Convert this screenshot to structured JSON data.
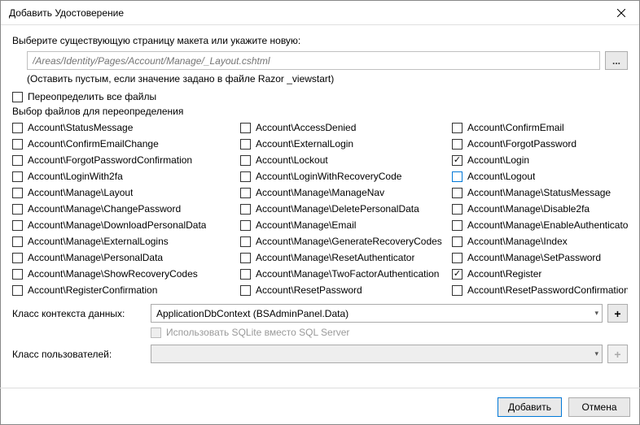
{
  "window": {
    "title": "Добавить Удостоверение"
  },
  "prompt": "Выберите существующую страницу макета или укажите новую:",
  "layout_path_placeholder": "/Areas/Identity/Pages/Account/Manage/_Layout.cshtml",
  "browse_btn": "...",
  "hint": "(Оставить пустым, если значение задано в файле Razor _viewstart)",
  "override_all_label": "Переопределить все файлы",
  "override_all_checked": false,
  "files_section_label": "Выбор файлов для переопределения",
  "files": [
    {
      "label": "Account\\StatusMessage",
      "c": false
    },
    {
      "label": "Account\\AccessDenied",
      "c": false
    },
    {
      "label": "Account\\ConfirmEmail",
      "c": false
    },
    {
      "label": "Account\\ConfirmEmailChange",
      "c": false
    },
    {
      "label": "Account\\ExternalLogin",
      "c": false
    },
    {
      "label": "Account\\ForgotPassword",
      "c": false
    },
    {
      "label": "Account\\ForgotPasswordConfirmation",
      "c": false
    },
    {
      "label": "Account\\Lockout",
      "c": false
    },
    {
      "label": "Account\\Login",
      "c": true
    },
    {
      "label": "Account\\LoginWith2fa",
      "c": false
    },
    {
      "label": "Account\\LoginWithRecoveryCode",
      "c": false
    },
    {
      "label": "Account\\Logout",
      "c": false,
      "hl": true
    },
    {
      "label": "Account\\Manage\\Layout",
      "c": false
    },
    {
      "label": "Account\\Manage\\ManageNav",
      "c": false
    },
    {
      "label": "Account\\Manage\\StatusMessage",
      "c": false
    },
    {
      "label": "Account\\Manage\\ChangePassword",
      "c": false
    },
    {
      "label": "Account\\Manage\\DeletePersonalData",
      "c": false
    },
    {
      "label": "Account\\Manage\\Disable2fa",
      "c": false
    },
    {
      "label": "Account\\Manage\\DownloadPersonalData",
      "c": false
    },
    {
      "label": "Account\\Manage\\Email",
      "c": false
    },
    {
      "label": "Account\\Manage\\EnableAuthenticator",
      "c": false
    },
    {
      "label": "Account\\Manage\\ExternalLogins",
      "c": false
    },
    {
      "label": "Account\\Manage\\GenerateRecoveryCodes",
      "c": false
    },
    {
      "label": "Account\\Manage\\Index",
      "c": false
    },
    {
      "label": "Account\\Manage\\PersonalData",
      "c": false
    },
    {
      "label": "Account\\Manage\\ResetAuthenticator",
      "c": false
    },
    {
      "label": "Account\\Manage\\SetPassword",
      "c": false
    },
    {
      "label": "Account\\Manage\\ShowRecoveryCodes",
      "c": false
    },
    {
      "label": "Account\\Manage\\TwoFactorAuthentication",
      "c": false
    },
    {
      "label": "Account\\Register",
      "c": true
    },
    {
      "label": "Account\\RegisterConfirmation",
      "c": false
    },
    {
      "label": "Account\\ResetPassword",
      "c": false
    },
    {
      "label": "Account\\ResetPasswordConfirmation",
      "c": false
    }
  ],
  "db_context_label": "Класс контекста данных:",
  "db_context_value": "ApplicationDbContext (BSAdminPanel.Data)",
  "sqlite_label": "Использовать SQLite вместо SQL Server",
  "user_class_label": "Класс пользователей:",
  "user_class_value": "",
  "footer": {
    "add": "Добавить",
    "cancel": "Отмена"
  }
}
